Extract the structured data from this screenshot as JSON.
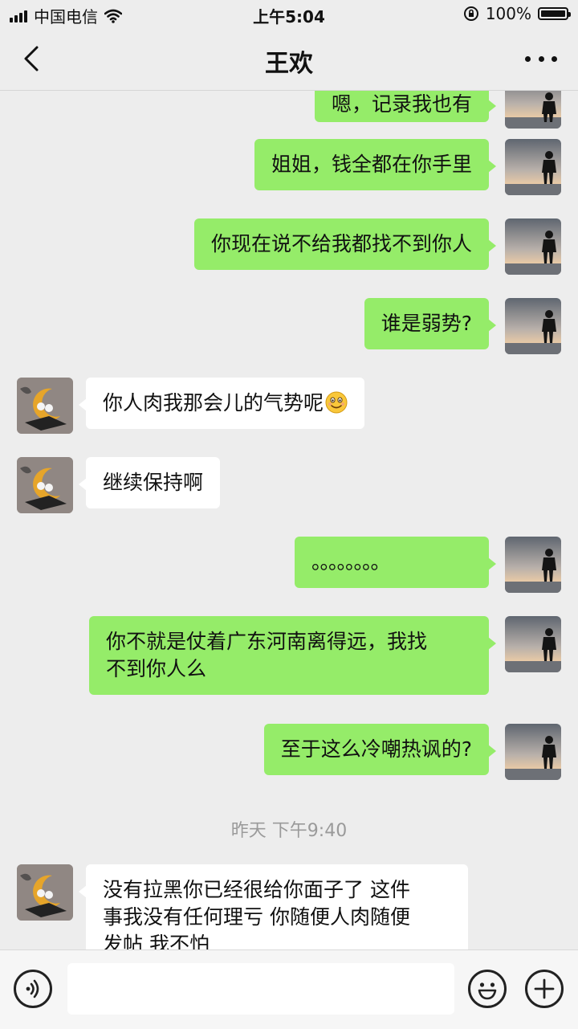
{
  "status_bar": {
    "carrier": "中国电信",
    "time": "上午5:04",
    "battery": "100%"
  },
  "nav": {
    "title": "王欢"
  },
  "messages": [
    {
      "side": "me",
      "text": "嗯，记录我也有"
    },
    {
      "side": "me",
      "text": "姐姐，钱全都在你手里"
    },
    {
      "side": "me",
      "text": "你现在说不给我都找不到你人"
    },
    {
      "side": "me",
      "text": "谁是弱势?"
    },
    {
      "side": "them",
      "text": "你人肉我那会儿的气势呢",
      "emoji": "smiling-face-icon"
    },
    {
      "side": "them",
      "text": "继续保持啊"
    },
    {
      "side": "me",
      "text": "。。。。。。。。"
    },
    {
      "side": "me",
      "text": "你不就是仗着广东河南离得远，我找\n不到你人么"
    },
    {
      "side": "me",
      "text": "至于这么冷嘲热讽的?"
    },
    {
      "side": "them",
      "text": "没有拉黑你已经很给你面子了 这件\n事我没有任何理亏 你随便人肉随便\n发帖 我不怕"
    }
  ],
  "timestamp": "昨天 下午9:40",
  "input": {
    "value": "",
    "placeholder": ""
  },
  "icons": {
    "back": "back-chevron-icon",
    "more": "more-dots-icon",
    "voice": "voice-icon",
    "emoji": "emoji-icon",
    "plus": "plus-icon"
  },
  "colors": {
    "my_bubble": "#95ec69",
    "their_bubble": "#ffffff",
    "background": "#ededed"
  }
}
